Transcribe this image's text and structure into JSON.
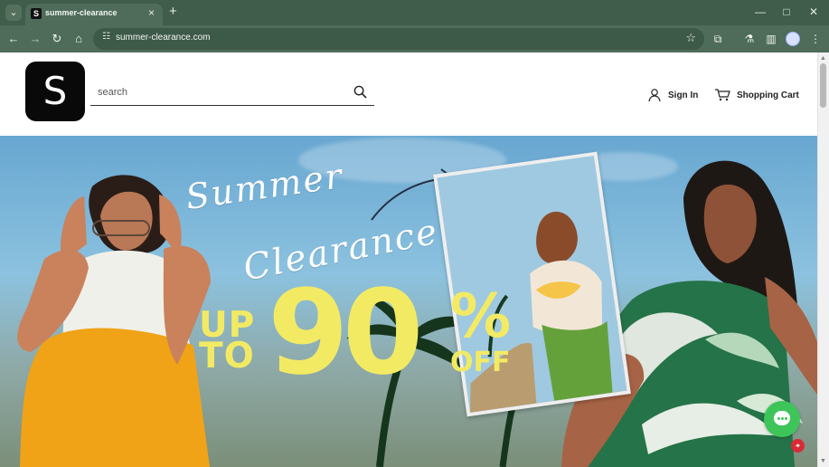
{
  "browser": {
    "tab_title": "summer-clearance",
    "tab_favicon_letter": "S",
    "url": "summer-clearance.com",
    "window_controls": [
      "minimize",
      "maximize",
      "close"
    ]
  },
  "header": {
    "logo_letter": "S",
    "search_placeholder": "search",
    "sign_in_label": "Sign In",
    "cart_label": "Shopping Cart"
  },
  "hero": {
    "script_line_1": "Summer",
    "script_line_2": "Clearance",
    "up_to": "UP\nTO",
    "discount_number": "90",
    "discount_symbol": "%",
    "off_label": "OFF",
    "accent_color": "#f3ea64"
  },
  "floating": {
    "chat_icon": "chat-icon",
    "notification_icon": "location-badge-icon"
  },
  "icons": {
    "tab_search": "chevron-down-icon",
    "new_tab": "plus-icon",
    "back": "arrow-left-icon",
    "forward": "arrow-right-icon",
    "reload": "reload-icon",
    "home": "home-icon",
    "site_info": "site-settings-icon",
    "bookmark": "star-icon",
    "extensions": "puzzle-icon",
    "labs": "flask-icon",
    "sidebar": "sidebar-icon",
    "profile": "profile-icon",
    "menu": "vertical-dots-icon",
    "search": "search-icon",
    "user": "user-icon",
    "cart": "cart-icon"
  }
}
